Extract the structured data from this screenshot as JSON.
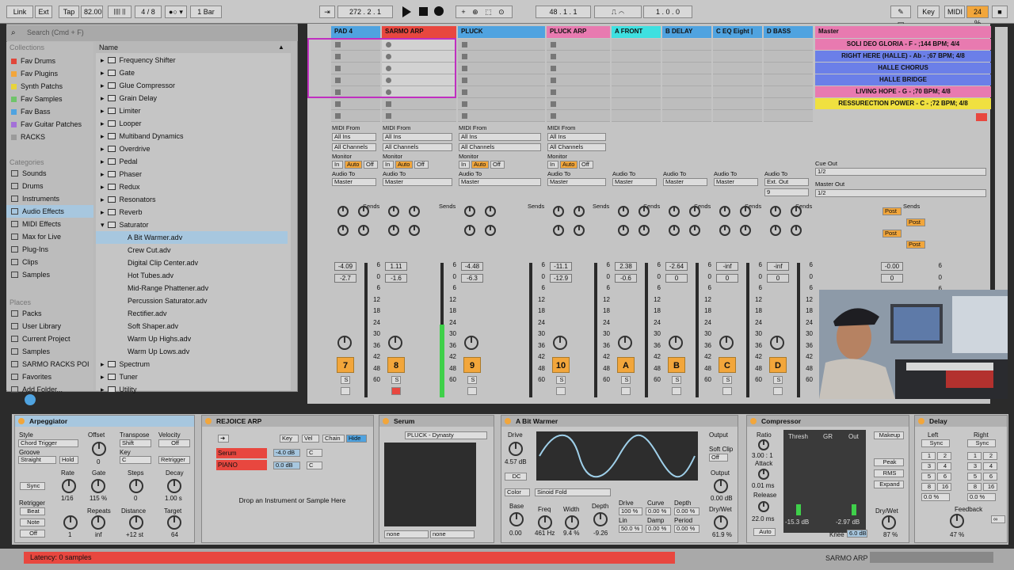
{
  "topbar": {
    "link": "Link",
    "ext": "Ext",
    "tap": "Tap",
    "tempo": "82.00",
    "sig": "4 / 8",
    "quant": "1 Bar",
    "pos": "272 .   2 .   1",
    "loop_start": "48 .   1 .   1",
    "loop_len": "1 .   0 .   0",
    "key": "Key",
    "midi": "MIDI",
    "cpu": "24 %"
  },
  "browser": {
    "search_placeholder": "Search (Cmd + F)",
    "collections_hdr": "Collections",
    "collections": [
      {
        "label": "Fav Drums",
        "color": "#e0463a"
      },
      {
        "label": "Fav Plugins",
        "color": "#f2a63b"
      },
      {
        "label": "Synth Patchs",
        "color": "#e8d43a"
      },
      {
        "label": "Fav Samples",
        "color": "#6fc46a"
      },
      {
        "label": "Fav Bass",
        "color": "#4fa3e0"
      },
      {
        "label": "Fav Guitar Patches",
        "color": "#a370d8"
      },
      {
        "label": "RACKS",
        "color": "#9a9a9a"
      }
    ],
    "categories_hdr": "Categories",
    "categories": [
      "Sounds",
      "Drums",
      "Instruments",
      "Audio Effects",
      "MIDI Effects",
      "Max for Live",
      "Plug-Ins",
      "Clips",
      "Samples"
    ],
    "places_hdr": "Places",
    "places": [
      "Packs",
      "User Library",
      "Current Project",
      "Samples",
      "SARMO RACKS POI",
      "Favorites",
      "Add Folder..."
    ],
    "name_hdr": "Name",
    "items": [
      "Frequency Shifter",
      "Gate",
      "Glue Compressor",
      "Grain Delay",
      "Limiter",
      "Looper",
      "Multiband Dynamics",
      "Overdrive",
      "Pedal",
      "Phaser",
      "Redux",
      "Resonators",
      "Reverb",
      "Saturator"
    ],
    "saturator_children": [
      "A Bit Warmer.adv",
      "Crew Cut.adv",
      "Digital Clip Center.adv",
      "Hot Tubes.adv",
      "Mid-Range Phattener.adv",
      "Percussion Saturator.adv",
      "Rectifier.adv",
      "Soft Shaper.adv",
      "Warm Up Highs.adv",
      "Warm Up Lows.adv"
    ],
    "items_after": [
      "Spectrum",
      "Tuner",
      "Utility"
    ]
  },
  "tracks": [
    {
      "name": "PAD 4",
      "color": "#4fa3e0",
      "num": "7",
      "vol": "-4.09",
      "pan": "-2.7"
    },
    {
      "name": "SARMO ARP",
      "color": "#e8473f",
      "num": "8",
      "vol": "1.11",
      "pan": "-1.6"
    },
    {
      "name": "PLUCK",
      "color": "#4fa3e0",
      "num": "9",
      "vol": "-4.48",
      "pan": "-6.3"
    },
    {
      "name": "PLUCK ARP",
      "color": "#e87ab0",
      "num": "10",
      "vol": "-11.1",
      "pan": "-12.9"
    },
    {
      "name": "A FRONT",
      "color": "#3ee0e0",
      "num": "A",
      "vol": "2.38",
      "pan": "-0.6"
    },
    {
      "name": "B DELAY",
      "color": "#4fa3e0",
      "num": "B",
      "vol": "-2.64",
      "pan": "0"
    },
    {
      "name": "C EQ Eight |",
      "color": "#4fa3e0",
      "num": "C",
      "vol": "-inf",
      "pan": "0"
    },
    {
      "name": "D BASS",
      "color": "#4fa3e0",
      "num": "D",
      "vol": "-inf",
      "pan": "0"
    }
  ],
  "io": {
    "midi_from": "MIDI From",
    "all_ins": "All Ins",
    "all_channels": "All Channels",
    "monitor": "Monitor",
    "in": "In",
    "auto": "Auto",
    "off": "Off",
    "audio_to": "Audio To",
    "master": "Master",
    "ext_out": "Ext. Out",
    "sends": "Sends",
    "nine": "9"
  },
  "master": {
    "name": "Master",
    "cue_out": "Cue Out",
    "cue_val": "1/2",
    "master_out": "Master Out",
    "master_val": "1/2",
    "vol": "-0.00",
    "pan": "0",
    "post": "Post",
    "scenes": [
      {
        "label": "SOLI DEO GLORIA - F - ;144 BPM; 4/4",
        "color": "#e87ab0"
      },
      {
        "label": "RIGHT HERE (HALLE) - Ab - ;67 BPM; 4/8",
        "color": "#6b7fe8"
      },
      {
        "label": "HALLE CHORUS",
        "color": "#6b7fe8"
      },
      {
        "label": "HALLE BRIDGE",
        "color": "#6b7fe8"
      },
      {
        "label": "LIVING HOPE - G - ;70 BPM; 4/8",
        "color": "#e87ab0"
      },
      {
        "label": "RESSURECTION POWER - C - ;72 BPM; 4/8",
        "color": "#f0e040"
      }
    ]
  },
  "scale": [
    "6",
    "0",
    "6",
    "12",
    "18",
    "24",
    "30",
    "36",
    "42",
    "48",
    "60"
  ],
  "devices": {
    "arp": {
      "title": "Arpeggiator",
      "style": "Style",
      "style_val": "Chord Trigger",
      "groove": "Groove",
      "groove_val": "Straight",
      "hold": "Hold",
      "offset": "Offset",
      "offset_val": "0",
      "transpose": "Transpose",
      "transpose_val": "Shift",
      "key": "Key",
      "key_val": "C",
      "velocity": "Velocity",
      "vel_val": "Off",
      "retrigger_btn": "Retrigger",
      "sync": "Sync",
      "rate": "Rate",
      "rate_val": "1/16",
      "gate": "Gate",
      "gate_val": "115 %",
      "steps": "Steps",
      "steps_val": "0",
      "decay": "Decay",
      "decay_val": "1.00 s",
      "retrigger": "Retrigger",
      "beat": "Beat",
      "note": "Note",
      "off": "Off",
      "repeats": "Repeats",
      "repeats_val": "inf",
      "distance": "Distance",
      "distance_val": "+12 st",
      "target": "Target",
      "target_val": "64",
      "one": "1"
    },
    "rejoice": {
      "title": "REJOICE ARP",
      "key": "Key",
      "vel": "Vel",
      "chain": "Chain",
      "hide": "Hide",
      "rows": [
        {
          "name": "Serum",
          "vol": "-4.0 dB",
          "pan": "C"
        },
        {
          "name": "PIANO",
          "vol": "0.0 dB",
          "pan": "C"
        }
      ],
      "drop": "Drop an Instrument or Sample Here"
    },
    "serum": {
      "title": "Serum",
      "preset": "PLUCK - Dynasty",
      "none1": "none",
      "none2": "none"
    },
    "warmer": {
      "title": "A Bit Warmer",
      "drive": "Drive",
      "drive_val": "4.57 dB",
      "dc": "DC",
      "output": "Output",
      "soft_clip": "Soft Clip",
      "off": "Off",
      "out_val": "0.00 dB",
      "color": "Color",
      "wave": "Sinoid Fold",
      "base": "Base",
      "base_val": "0.00",
      "freq": "Freq",
      "freq_val": "461 Hz",
      "width": "Width",
      "width_val": "9.4 %",
      "depth": "Depth",
      "depth_val": "-9.26",
      "drive2": "Drive",
      "drive2_val": "100 %",
      "curve": "Curve",
      "curve_val": "0.00 %",
      "depth2": "Depth",
      "depth2_val": "0.00 %",
      "lin": "Lin",
      "lin_val": "50.0 %",
      "damp": "Damp",
      "damp_val": "0.00 %",
      "period": "Period",
      "period_val": "0.00 %",
      "drywet": "Dry/Wet",
      "drywet_val": "61.9 %"
    },
    "comp": {
      "title": "Compressor",
      "ratio": "Ratio",
      "ratio_val": "3.00 : 1",
      "attack": "Attack",
      "attack_val": "0.01 ms",
      "release": "Release",
      "release_val": "22.0 ms",
      "auto": "Auto",
      "thresh": "Thresh",
      "gr": "GR",
      "out": "Out",
      "thresh_val": "-15.3 dB",
      "out_val": "-2.97 dB",
      "makeup": "Makeup",
      "peak": "Peak",
      "rms": "RMS",
      "expand": "Expand",
      "drywet": "Dry/Wet",
      "drywet_val": "87 %",
      "knee": "Knee",
      "knee_val": "6.0 dB"
    },
    "delay": {
      "title": "Delay",
      "left": "Left",
      "right": "Right",
      "sync": "Sync",
      "grid": [
        "1",
        "2",
        "3",
        "4",
        "5",
        "6",
        "8",
        "16"
      ],
      "left_pct": "0.0 %",
      "right_pct": "0.0 %",
      "feedback": "Feedback",
      "fb_val": "47 %"
    }
  },
  "status": {
    "latency": "Latency: 0 samples",
    "track": "SARMO ARP"
  }
}
